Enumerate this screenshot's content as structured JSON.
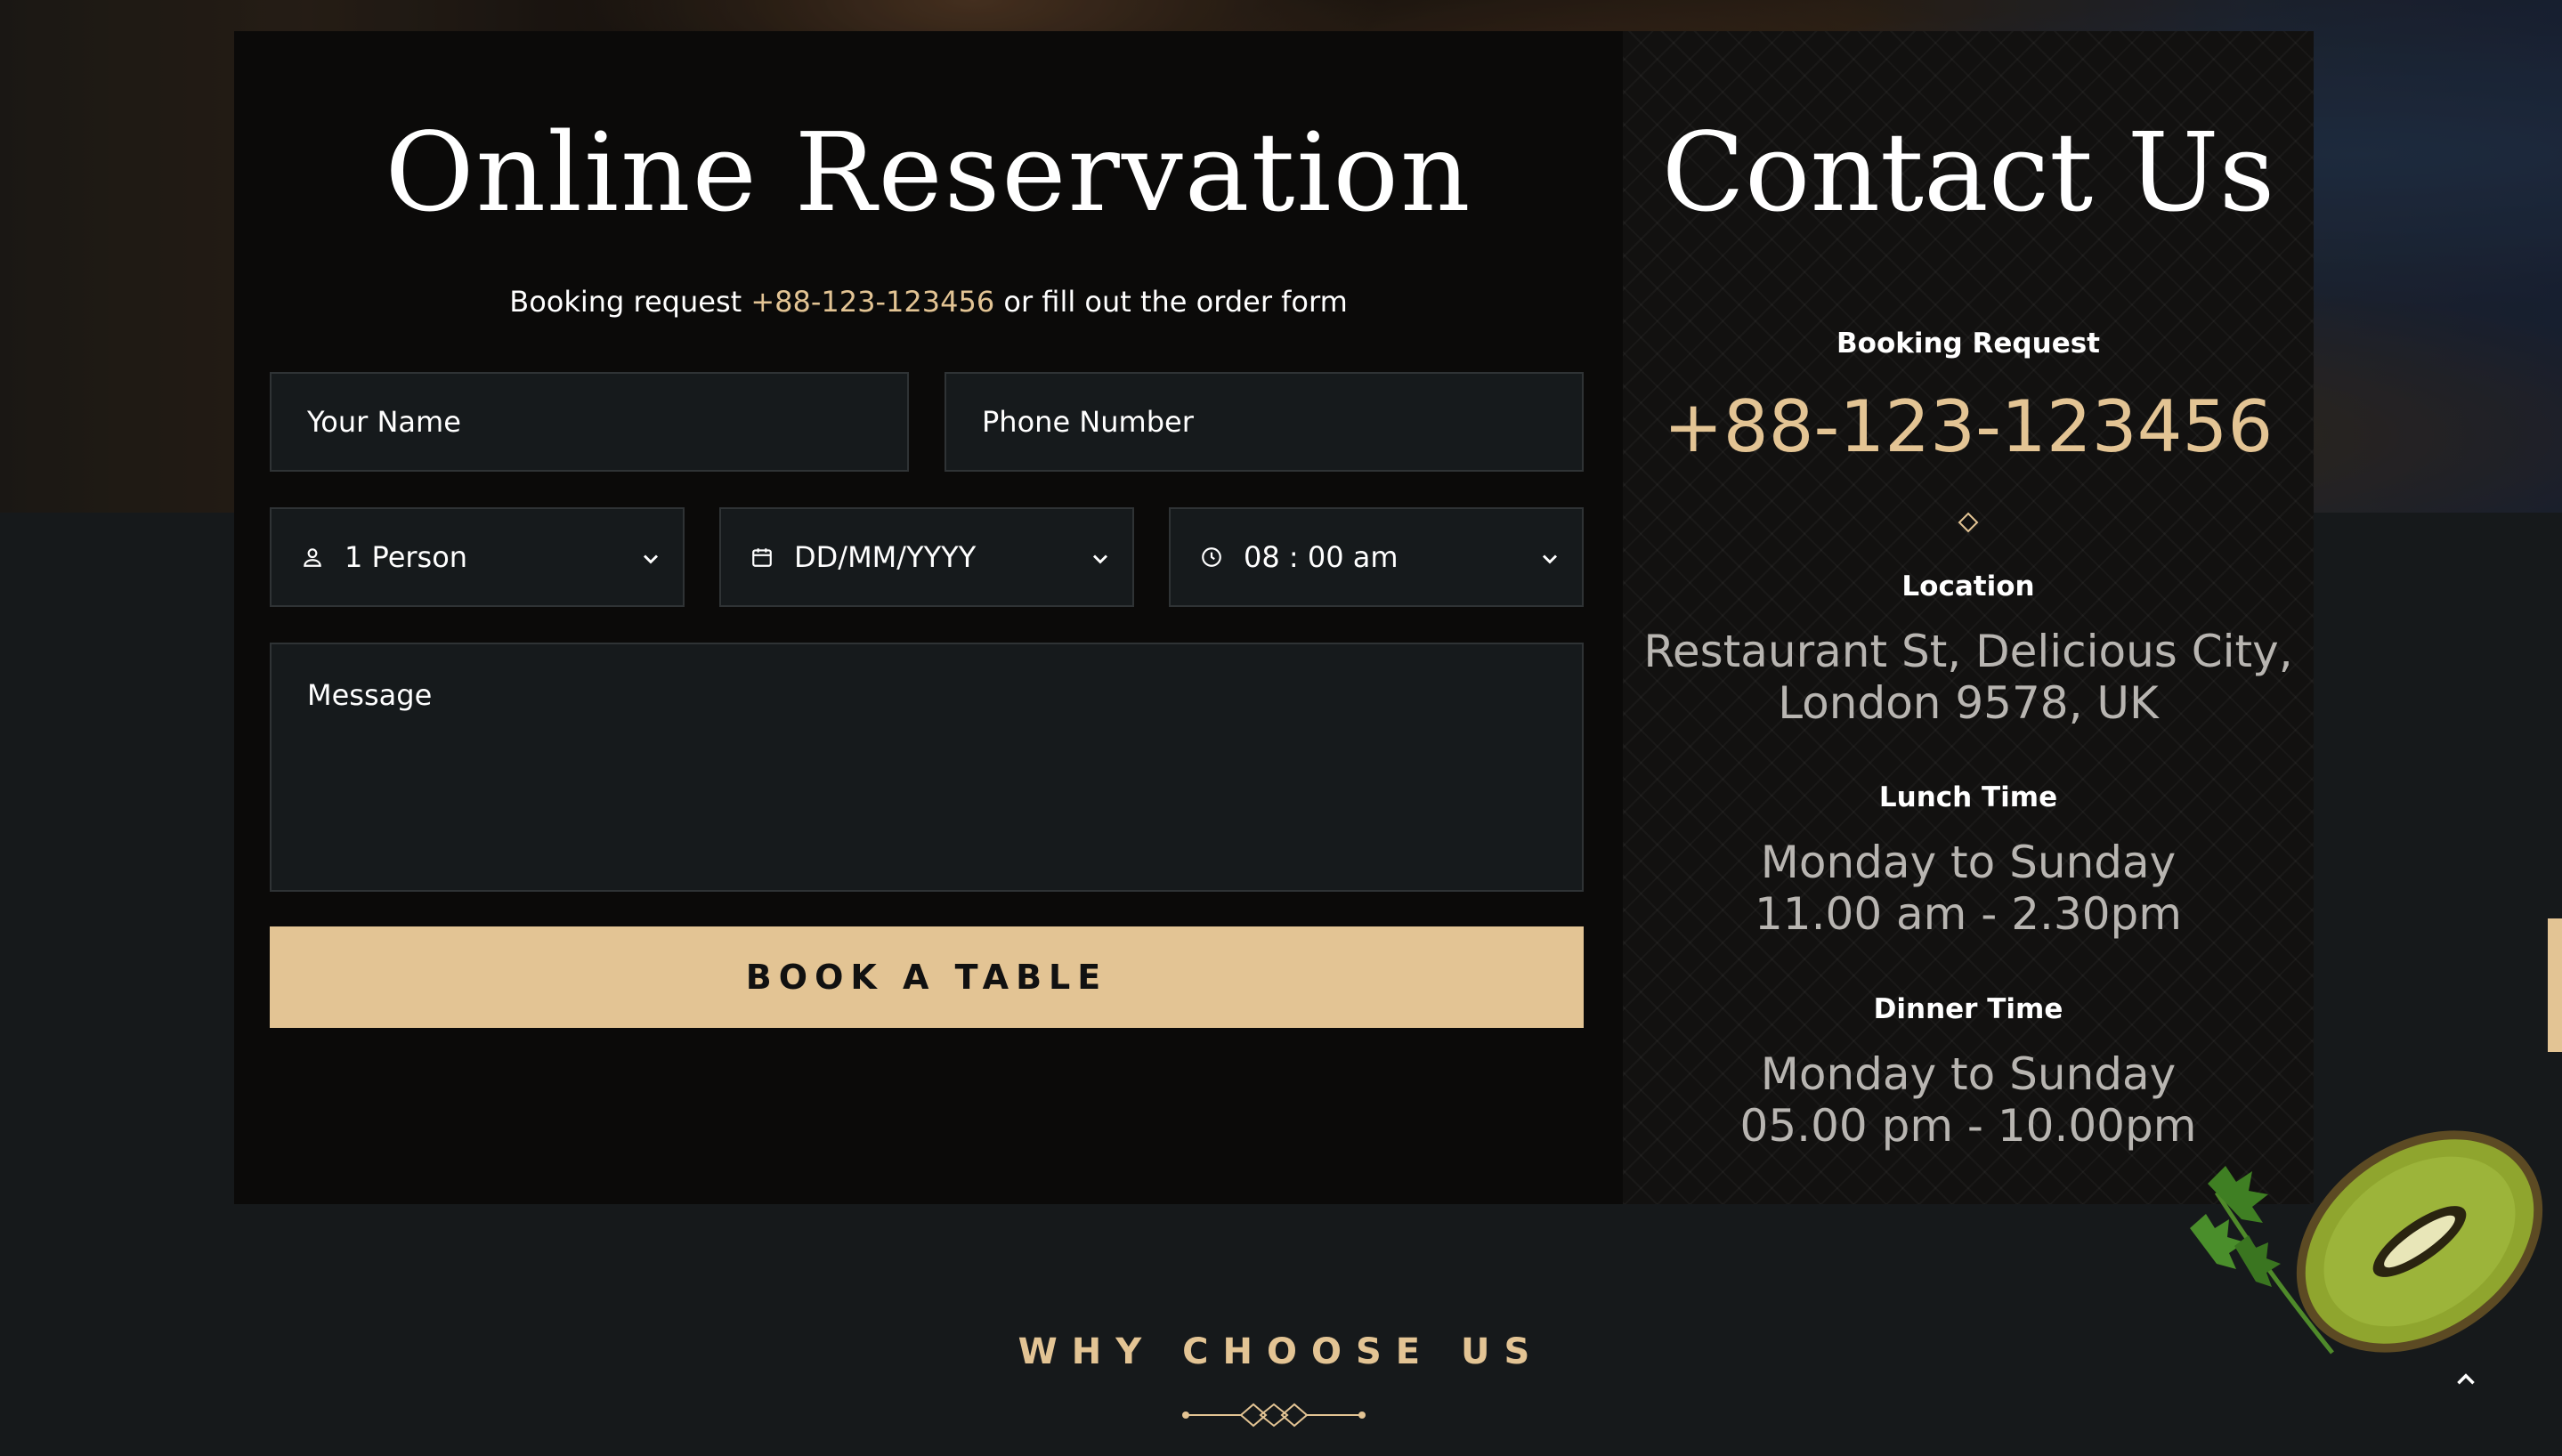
{
  "reservation": {
    "title": "Online Reservation",
    "subtitle_prefix": "Booking request ",
    "subtitle_phone": "+88-123-123456",
    "subtitle_suffix": " or fill out the order form",
    "name_placeholder": "Your Name",
    "phone_placeholder": "Phone Number",
    "persons_value": "1 Person",
    "date_value": "DD/MM/YYYY",
    "time_value": "08 : 00 am",
    "message_placeholder": "Message",
    "book_button": "BOOK A TABLE"
  },
  "contact": {
    "title": "Contact Us",
    "booking_label": "Booking Request",
    "booking_phone": "+88-123-123456",
    "location_label": "Location",
    "location_line1": "Restaurant St, Delicious City,",
    "location_line2": "London 9578, UK",
    "lunch_label": "Lunch Time",
    "lunch_line1": "Monday to Sunday",
    "lunch_line2": "11.00 am - 2.30pm",
    "dinner_label": "Dinner Time",
    "dinner_line1": "Monday to Sunday",
    "dinner_line2": "05.00 pm - 10.00pm"
  },
  "why": {
    "title": "WHY CHOOSE US"
  },
  "colors": {
    "accent": "#e3c494",
    "panel": "#0b0a09",
    "page": "#16191b"
  },
  "icons": [
    "user-icon",
    "calendar-icon",
    "clock-icon",
    "chevron-down-icon",
    "diamond-icon",
    "chevron-up-icon"
  ]
}
